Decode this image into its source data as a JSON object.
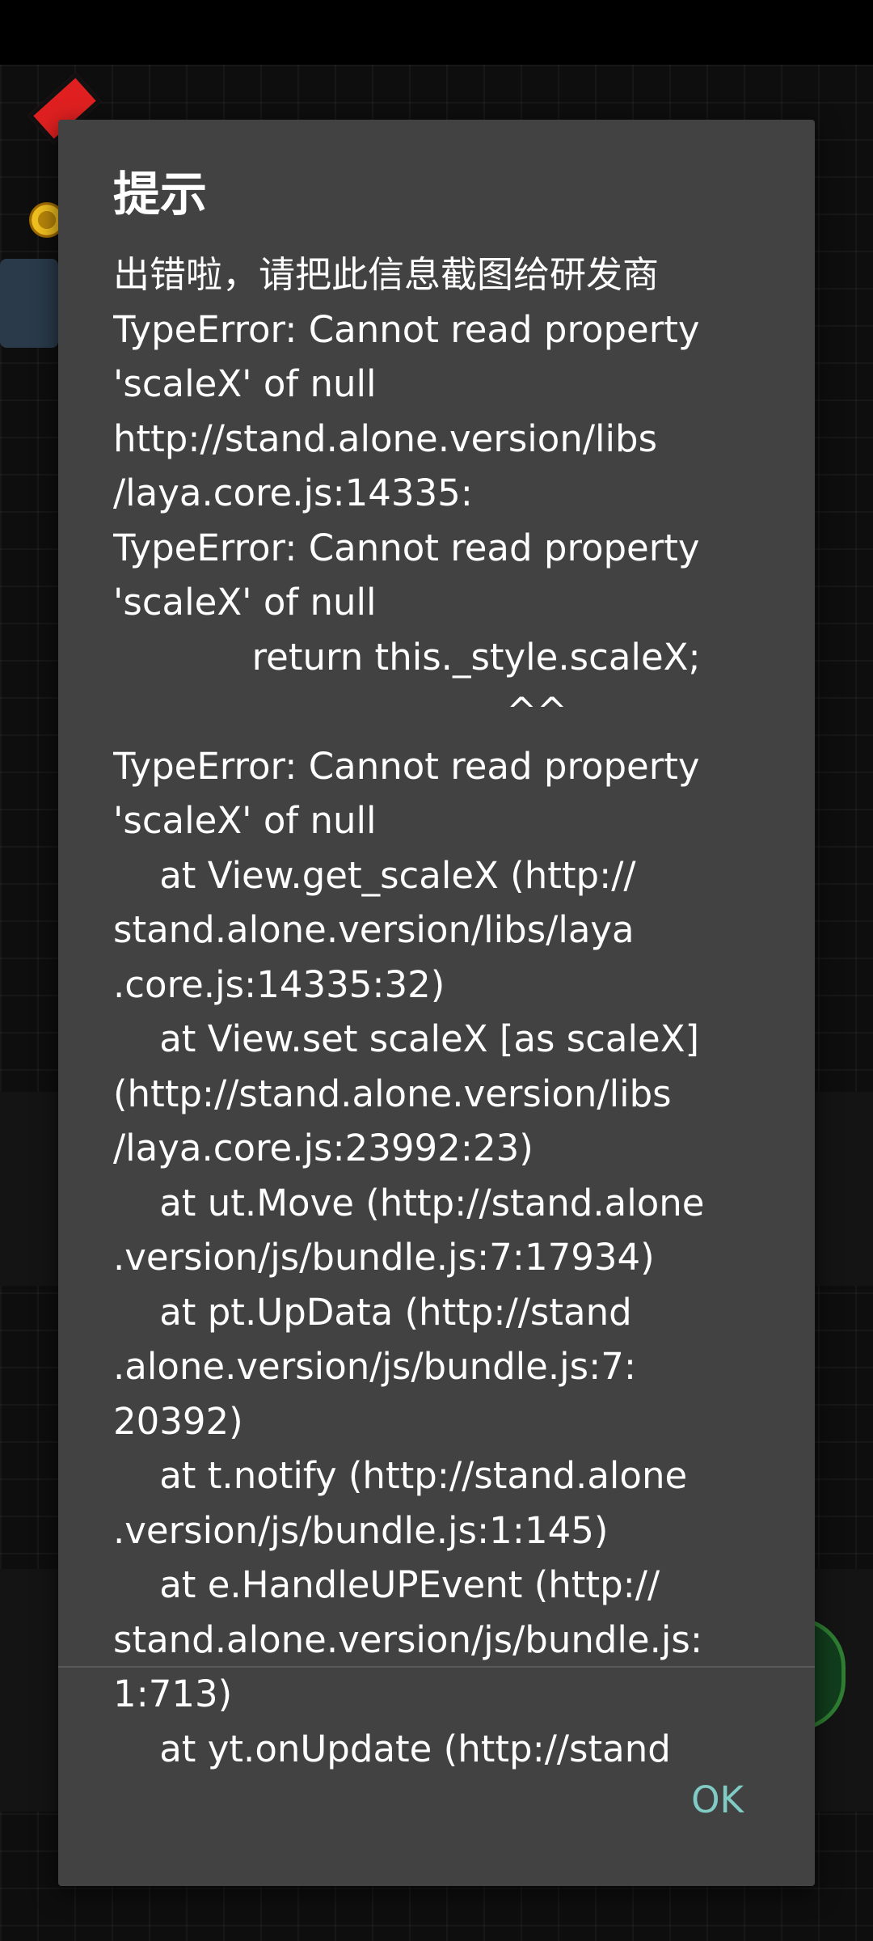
{
  "dialog": {
    "title": "提示",
    "message_lines": [
      "出错啦，请把此信息截图给研发商",
      "TypeError: Cannot read property",
      "'scaleX' of null",
      "http://stand.alone.version/libs",
      "/laya.core.js:14335:",
      "TypeError: Cannot read property",
      "'scaleX' of null",
      "            return this._style.scaleX;",
      "                                  ^^",
      "TypeError: Cannot read property",
      "'scaleX' of null",
      "    at View.get_scaleX (http://",
      "stand.alone.version/libs/laya",
      ".core.js:14335:32)",
      "    at View.set scaleX [as scaleX]",
      "(http://stand.alone.version/libs",
      "/laya.core.js:23992:23)",
      "    at ut.Move (http://stand.alone",
      ".version/js/bundle.js:7:17934)",
      "    at pt.UpData (http://stand",
      ".alone.version/js/bundle.js:7:",
      "20392)",
      "    at t.notify (http://stand.alone",
      ".version/js/bundle.js:1:145)",
      "    at e.HandleUPEvent (http://",
      "stand.alone.version/js/bundle.js:",
      "1:713)",
      "    at yt.onUpdate (http://stand"
    ],
    "ok_label": "OK"
  },
  "colors": {
    "dialog_background": "#424242",
    "text": "#ffffff",
    "accent": "#80cbc4"
  }
}
